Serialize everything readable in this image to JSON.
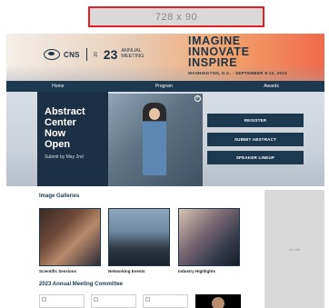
{
  "ad_top": {
    "label": "728 x 90"
  },
  "banner": {
    "org": "CNS",
    "year_prefix": "20",
    "year": "23",
    "annual_line1": "ANNUAL",
    "annual_line2": "MEETING",
    "headline": [
      "IMAGINE",
      "INNOVATE",
      "INSPIRE"
    ],
    "subline": "WASHINGTON, D.C. · SEPTEMBER 9-13, 2023"
  },
  "nav": [
    "Home",
    "Program",
    "Awards"
  ],
  "hero": {
    "title": [
      "Abstract",
      "Center",
      "Now",
      "Open"
    ],
    "subtitle": "Submit by May 2nd",
    "close_glyph": "×"
  },
  "cta": [
    "REGISTER",
    "SUBMIT ABSTRACT",
    "SPEAKER LINEUP"
  ],
  "galleries": {
    "title": "Image Galleries",
    "items": [
      "Scientific Sessions",
      "Networking Events",
      "Industry Highlights"
    ]
  },
  "committee": {
    "title": "2023 Annual Meeting Committee"
  },
  "side_ad": {
    "label": "Ad slot"
  }
}
